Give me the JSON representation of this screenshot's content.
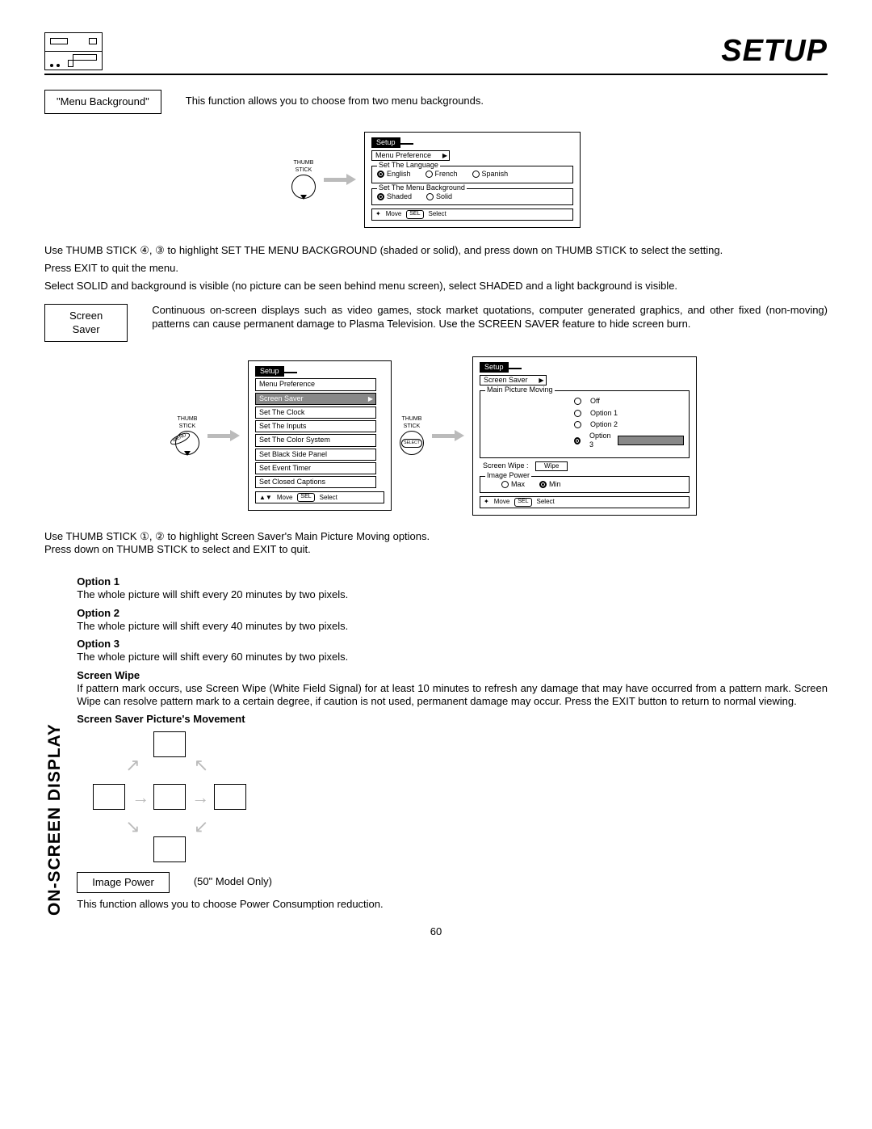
{
  "header": {
    "title": "SETUP"
  },
  "menuBackground": {
    "label": "\"Menu Background\"",
    "desc": "This function allows you to choose from two menu backgrounds.",
    "thumb": "THUMB\nSTICK",
    "osd": {
      "tab": "Setup",
      "sub": "Menu Preference",
      "lang": {
        "legend": "Set The Language",
        "opts": [
          "English",
          "French",
          "Spanish"
        ]
      },
      "bg": {
        "legend": "Set The Menu Background",
        "opts": [
          "Shaded",
          "Solid"
        ]
      },
      "foot": {
        "move": "Move",
        "sel": "SEL",
        "select": "Select"
      }
    },
    "steps": [
      "Use THUMB STICK ④, ③ to highlight SET THE MENU BACKGROUND (shaded or solid), and press down on THUMB STICK to select the setting.",
      "Press EXIT to quit the menu.",
      "Select SOLID and background is visible (no picture can be seen behind menu screen), select SHADED and a light background is visible."
    ]
  },
  "screenSaver": {
    "label": "Screen\nSaver",
    "desc": "Continuous on-screen displays such as video games, stock market quotations, computer generated graphics, and other fixed (non-moving) patterns can cause permanent damage to Plasma Television.  Use the SCREEN SAVER feature to hide screen burn.",
    "thumb": "THUMB\nSTICK",
    "menuTag": "MENU",
    "listOsd": {
      "tab": "Setup",
      "items": [
        "Menu Preference",
        "Screen Saver",
        "Set The Clock",
        "Set The Inputs",
        "Set The Color System",
        "Set Black Side Panel",
        "Set Event Timer",
        "Set Closed Captions"
      ],
      "foot": {
        "move": "Move",
        "sel": "SEL",
        "select": "Select"
      }
    },
    "ssOsd": {
      "tab": "Setup",
      "sub": "Screen Saver",
      "mpm": {
        "legend": "Main Picture Moving",
        "opts": [
          "Off",
          "Option 1",
          "Option 2",
          "Option 3"
        ]
      },
      "wipe": {
        "label": "Screen Wipe :",
        "btn": "Wipe"
      },
      "ip": {
        "legend": "Image Power",
        "opts": [
          "Max",
          "Min"
        ]
      },
      "foot": {
        "move": "Move",
        "sel": "SEL",
        "select": "Select"
      }
    },
    "selectLabel": "SELECT",
    "steps": [
      "Use THUMB STICK ①, ② to highlight Screen Saver's Main Picture Moving options.",
      "Press down on THUMB STICK to select and EXIT to quit."
    ],
    "options": [
      {
        "title": "Option 1",
        "body": "The whole picture will shift every 20 minutes by two pixels."
      },
      {
        "title": "Option 2",
        "body": "The whole picture will shift every 40 minutes by two pixels."
      },
      {
        "title": "Option 3",
        "body": "The whole picture will shift every 60 minutes by two pixels."
      }
    ],
    "wipeSection": {
      "title": "Screen Wipe",
      "body": "If pattern mark occurs, use Screen Wipe (White Field Signal) for at least 10 minutes to refresh any damage that may have occurred from a pattern mark.  Screen Wipe can resolve pattern mark to a certain degree, if caution is not used, permanent damage may occur. Press the EXIT button to return to normal viewing."
    },
    "movementTitle": "Screen Saver Picture's Movement"
  },
  "imagePower": {
    "label": "Image Power",
    "note": "(50\" Model Only)",
    "desc": "This function allows you to choose Power Consumption reduction."
  },
  "sidebar": "ON-SCREEN DISPLAY",
  "pageNum": "60"
}
